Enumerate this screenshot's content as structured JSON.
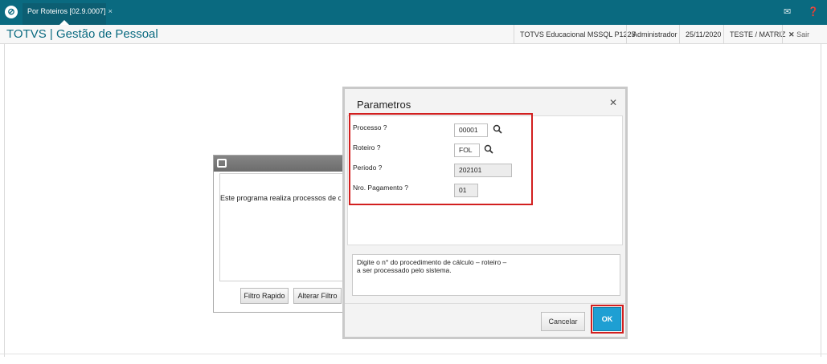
{
  "topbar": {
    "tab_label": "Por Roteiros [02.9.0007]",
    "tab_close": "×",
    "logo_icon": "totvs-logo-icon",
    "mail_icon": "mail-icon",
    "help_icon": "help-icon"
  },
  "header": {
    "title": "TOTVS | Gestão de Pessoal",
    "environment": "TOTVS Educacional MSSQL P1225",
    "user": "Administrador",
    "date": "25/11/2020",
    "company": "TESTE / MATRIZ",
    "exit_label": "Sair"
  },
  "background_window": {
    "message": "Este programa realiza processos de c",
    "buttons": [
      "Filtro Rapido",
      "Alterar Filtro"
    ]
  },
  "dialog": {
    "title": "Parametros",
    "fields": [
      {
        "label": "Processo ?",
        "value": "00001"
      },
      {
        "label": "Roteiro ?",
        "value": "FOL"
      },
      {
        "label": "Periodo ?",
        "value": "202101"
      },
      {
        "label": "Nro. Pagamento ?",
        "value": "01"
      }
    ],
    "help_lines": [
      "Digite o n° do procedimento de cálculo – roteiro –",
      "a ser processado pelo sistema."
    ],
    "cancel_label": "Cancelar",
    "ok_label": "OK"
  },
  "colors": {
    "brand": "#0a6a80",
    "ok_button": "#1e9fd3",
    "highlight": "#d21f1f"
  }
}
